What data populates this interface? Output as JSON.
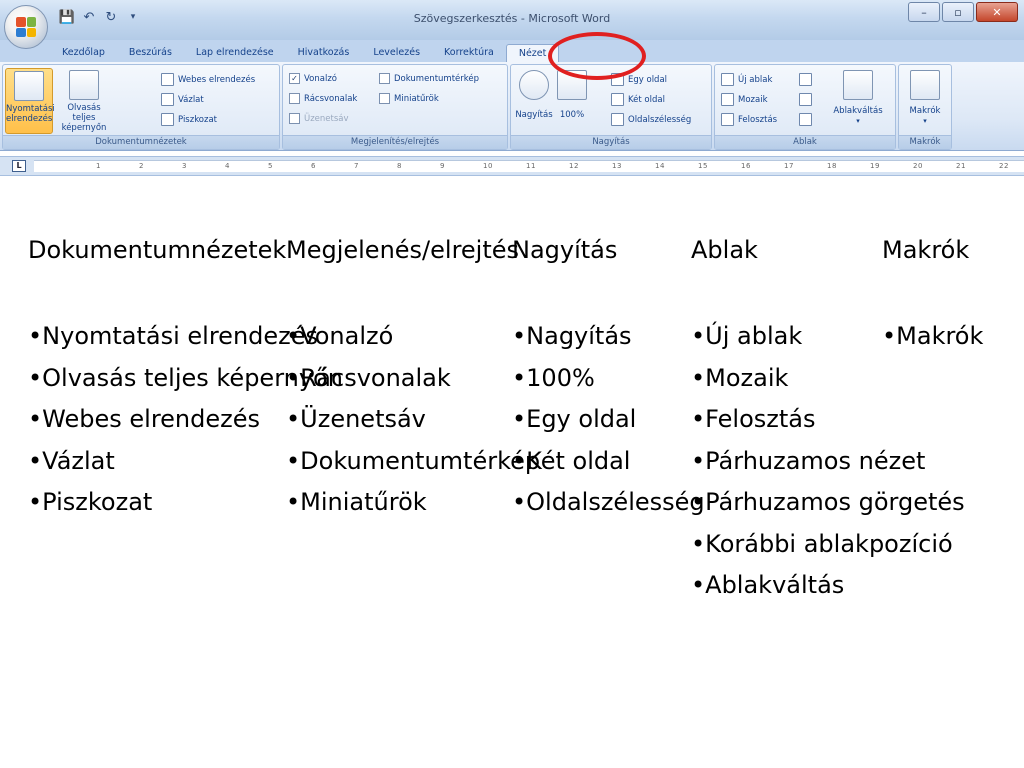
{
  "window": {
    "title": "Szövegszerkesztés - Microsoft Word",
    "controls": {
      "minimize": "–",
      "maximize": "▫",
      "close": "✕"
    }
  },
  "qat": {
    "save_icon": "save-icon",
    "undo_icon": "undo-icon",
    "redo_icon": "redo-icon",
    "customize_icon": "dropdown-icon"
  },
  "tabs": [
    {
      "label": "Kezdőlap"
    },
    {
      "label": "Beszúrás"
    },
    {
      "label": "Lap elrendezése"
    },
    {
      "label": "Hivatkozás"
    },
    {
      "label": "Levelezés"
    },
    {
      "label": "Korrektúra"
    },
    {
      "label": "Nézet",
      "active": true
    }
  ],
  "ribbon": {
    "dokumentumnezetek": {
      "label": "Dokumentumnézetek",
      "nyomtatasi": "Nyomtatási elrendezés",
      "nyomtatasi_l1": "Nyomtatási",
      "nyomtatasi_l2": "elrendezés",
      "olvasas_l1": "Olvasás teljes",
      "olvasas_l2": "képernyőn",
      "webes": "Webes elrendezés",
      "vazlat": "Vázlat",
      "piszkozat": "Piszkozat"
    },
    "megjelenites": {
      "label": "Megjelenítés/elrejtés",
      "vonalzo": "Vonalzó",
      "racsvonalak": "Rácsvonalak",
      "uzenetsav": "Üzenetsáv",
      "dokumentumterkep": "Dokumentumtérkép",
      "miniaturok": "Miniatűrök"
    },
    "nagyitas": {
      "label": "Nagyítás",
      "nagyitas": "Nagyítás",
      "szaz": "100%",
      "egy_oldal": "Egy oldal",
      "ket_oldal": "Két oldal",
      "oldalszelesseg": "Oldalszélesség"
    },
    "ablak": {
      "label": "Ablak",
      "uj_ablak": "Új ablak",
      "mozaik": "Mozaik",
      "felosztas": "Felosztás",
      "ablakvaltas": "Ablakváltás"
    },
    "makrok": {
      "label": "Makrók",
      "makrok": "Makrók"
    }
  },
  "ruler": {
    "tab_selector": "L",
    "numbers": [
      "1",
      "2",
      "3",
      "4",
      "5",
      "6",
      "7",
      "8",
      "9",
      "10",
      "11",
      "12",
      "13",
      "14",
      "15",
      "16",
      "17",
      "18",
      "19",
      "20",
      "21",
      "22"
    ]
  },
  "slide": {
    "columns": [
      {
        "heading": "Dokumentumnézetek",
        "items": [
          "Nyomtatási elrendezés",
          "Olvasás teljes képernyőn",
          "Webes elrendezés",
          "Vázlat",
          "Piszkozat"
        ]
      },
      {
        "heading": "Megjelenés/elrejtés",
        "items": [
          "Vonalzó",
          "Rácsvonalak",
          "Üzenetsáv",
          "Dokumentumtérkép",
          "Miniatűrök"
        ]
      },
      {
        "heading": "Nagyítás",
        "items": [
          "Nagyítás",
          "100%",
          "Egy oldal",
          "Két oldal",
          "Oldalszélesség"
        ]
      },
      {
        "heading": "Ablak",
        "items": [
          "Új ablak",
          "Mozaik",
          "Felosztás",
          "Párhuzamos nézet",
          "Párhuzamos görgetés",
          "Korábbi ablakpozíció",
          "Ablakváltás"
        ]
      },
      {
        "heading": "Makrók",
        "items": [
          "Makrók"
        ]
      }
    ]
  },
  "colors": {
    "annotation": "#e02020",
    "ribbon_text": "#15428b",
    "active_button": "#ffc04a"
  }
}
